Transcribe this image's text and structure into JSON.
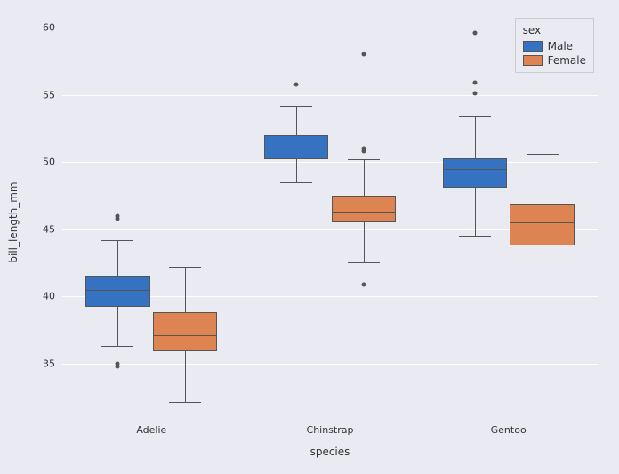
{
  "chart_data": {
    "type": "box",
    "xlabel": "species",
    "ylabel": "bill_length_mm",
    "categories": [
      "Adelie",
      "Chinstrap",
      "Gentoo"
    ],
    "y_ticks": [
      35,
      40,
      45,
      50,
      55,
      60
    ],
    "ylim": [
      31,
      61
    ],
    "legend": {
      "title": "sex",
      "entries": [
        {
          "name": "Male",
          "color": "#3672c2"
        },
        {
          "name": "Female",
          "color": "#dd8452"
        }
      ]
    },
    "series": [
      {
        "name": "Male",
        "color": "#3672c2",
        "boxes": [
          {
            "category": "Adelie",
            "whisker_low": 36.3,
            "q1": 39.2,
            "median": 40.5,
            "q3": 41.5,
            "whisker_high": 44.2,
            "outliers": [
              34.8,
              35.0,
              45.8,
              46.0
            ]
          },
          {
            "category": "Chinstrap",
            "whisker_low": 48.5,
            "q1": 50.2,
            "median": 51.0,
            "q3": 52.0,
            "whisker_high": 54.2,
            "outliers": [
              55.8
            ]
          },
          {
            "category": "Gentoo",
            "whisker_low": 44.5,
            "q1": 48.1,
            "median": 49.5,
            "q3": 50.3,
            "whisker_high": 53.4,
            "outliers": [
              55.1,
              55.9,
              59.6
            ]
          }
        ]
      },
      {
        "name": "Female",
        "color": "#dd8452",
        "boxes": [
          {
            "category": "Adelie",
            "whisker_low": 32.1,
            "q1": 35.9,
            "median": 37.1,
            "q3": 38.8,
            "whisker_high": 42.2,
            "outliers": []
          },
          {
            "category": "Chinstrap",
            "whisker_low": 42.5,
            "q1": 45.5,
            "median": 46.3,
            "q3": 47.5,
            "whisker_high": 50.2,
            "outliers": [
              40.9,
              50.8,
              51.0,
              58.0
            ]
          },
          {
            "category": "Gentoo",
            "whisker_low": 40.9,
            "q1": 43.8,
            "median": 45.5,
            "q3": 46.9,
            "whisker_high": 50.6,
            "outliers": []
          }
        ]
      }
    ]
  }
}
